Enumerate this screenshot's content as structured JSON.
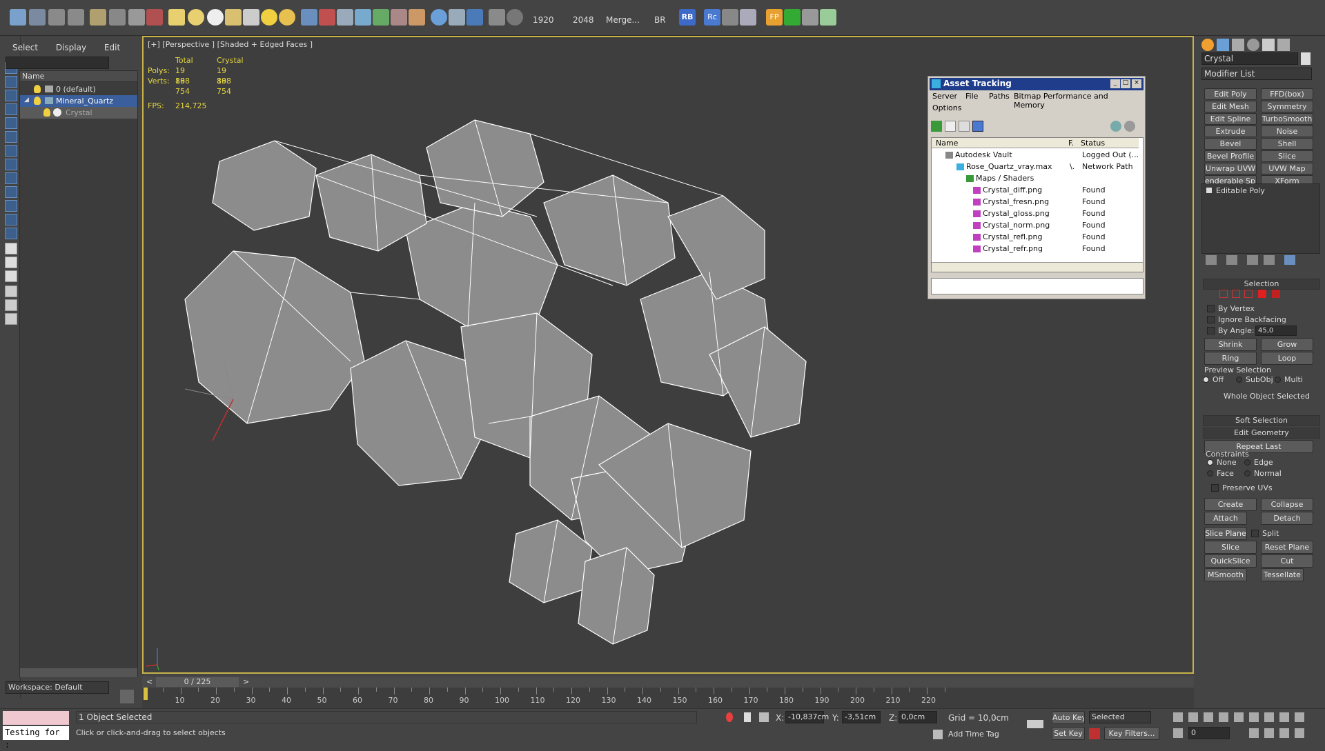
{
  "toolbar": {
    "render_w": "1920",
    "render_h": "2048",
    "merge": "Merge...",
    "br": "BR",
    "rb": "RB",
    "rc": "Rc",
    "fp": "FP"
  },
  "scene_explorer": {
    "menu": [
      "Select",
      "Display",
      "Edit"
    ],
    "column": "Name",
    "rows": [
      "0 (default)",
      "Mineral_Quartz",
      "Crystal"
    ],
    "workspace": "Workspace: Default"
  },
  "viewport": {
    "label": "[+] [Perspective ] [Shaded + Edged Faces ]",
    "stats": {
      "h_total": "Total",
      "h_obj": "Crystal",
      "polys_label": "Polys:",
      "polys_total": "19 888",
      "polys_obj": "19 888",
      "verts_label": "Verts:",
      "verts_total": "19 754",
      "verts_obj": "19 754",
      "fps_label": "FPS:",
      "fps_value": "214,725"
    },
    "axis": {
      "z": "z",
      "x": "x",
      "y": "y"
    }
  },
  "asset_tracking": {
    "title": "Asset Tracking",
    "menu": [
      "Server",
      "File",
      "Paths",
      "Bitmap Performance and Memory",
      "Options"
    ],
    "col_name": "Name",
    "col_f": "F.",
    "col_status": "Status",
    "rows": [
      {
        "name": "Autodesk Vault",
        "f": "",
        "status": "Logged Out (..."
      },
      {
        "name": "Rose_Quartz_vray.max",
        "f": "\\.",
        "status": "Network Path"
      },
      {
        "name": "Maps / Shaders",
        "f": "",
        "status": ""
      },
      {
        "name": "Crystal_diff.png",
        "f": "",
        "status": "Found"
      },
      {
        "name": "Crystal_fresn.png",
        "f": "",
        "status": "Found"
      },
      {
        "name": "Crystal_gloss.png",
        "f": "",
        "status": "Found"
      },
      {
        "name": "Crystal_norm.png",
        "f": "",
        "status": "Found"
      },
      {
        "name": "Crystal_refl.png",
        "f": "",
        "status": "Found"
      },
      {
        "name": "Crystal_refr.png",
        "f": "",
        "status": "Found"
      }
    ]
  },
  "command_panel": {
    "object_name": "Crystal",
    "modifier_list": "Modifier List",
    "modifiers": [
      "Edit Poly",
      "FFD(box)",
      "Edit Mesh",
      "Symmetry",
      "Edit Spline",
      "TurboSmooth",
      "Extrude",
      "Noise",
      "Bevel",
      "Shell",
      "Bevel Profile",
      "Slice",
      "Unwrap UVW",
      "UVW Map",
      "enderable Splir",
      "XForm"
    ],
    "stack_item": "Editable Poly",
    "selection": {
      "title": "Selection",
      "by_vertex": "By Vertex",
      "ignore_backfacing": "Ignore Backfacing",
      "by_angle": "By Angle:",
      "angle_value": "45,0",
      "shrink": "Shrink",
      "grow": "Grow",
      "ring": "Ring",
      "loop": "Loop",
      "preview": "Preview Selection",
      "off": "Off",
      "subobj": "SubObj",
      "multi": "Multi",
      "status": "Whole Object Selected"
    },
    "soft_selection": "Soft Selection",
    "edit_geometry": "Edit Geometry",
    "repeat_last": "Repeat Last",
    "constraints": "Constraints",
    "none": "None",
    "edge": "Edge",
    "face": "Face",
    "normal": "Normal",
    "preserve_uvs": "Preserve UVs",
    "create": "Create",
    "collapse": "Collapse",
    "attach": "Attach",
    "detach": "Detach",
    "slice_plane": "Slice Plane",
    "split": "Split",
    "slice": "Slice",
    "reset_plane": "Reset Plane",
    "quickslice": "QuickSlice",
    "cut": "Cut",
    "msmooth": "MSmooth",
    "tessellate": "Tessellate"
  },
  "timeline": {
    "frame": "0 / 225",
    "ticks": [
      "10",
      "20",
      "30",
      "40",
      "50",
      "60",
      "70",
      "80",
      "90",
      "100",
      "110",
      "120",
      "130",
      "140",
      "150",
      "160",
      "170",
      "180",
      "190",
      "200",
      "210",
      "220"
    ]
  },
  "status": {
    "script_input": "Testing for :",
    "selected": "1 Object Selected",
    "prompt": "Click or click-and-drag to select objects",
    "x_label": "X:",
    "x": "-10,837cm",
    "y_label": "Y:",
    "y": "-3,51cm",
    "z_label": "Z:",
    "z": "0,0cm",
    "grid": "Grid = 10,0cm",
    "add_time_tag": "Add Time Tag",
    "auto_key": "Auto Key",
    "set_key": "Set Key",
    "key_mode": "Selected",
    "key_filters": "Key Filters...",
    "frame": "0"
  },
  "colors": {
    "accent": "#3d5f8c",
    "viewport_border": "#c9b24a",
    "selected_row": "#3a5f9c"
  }
}
